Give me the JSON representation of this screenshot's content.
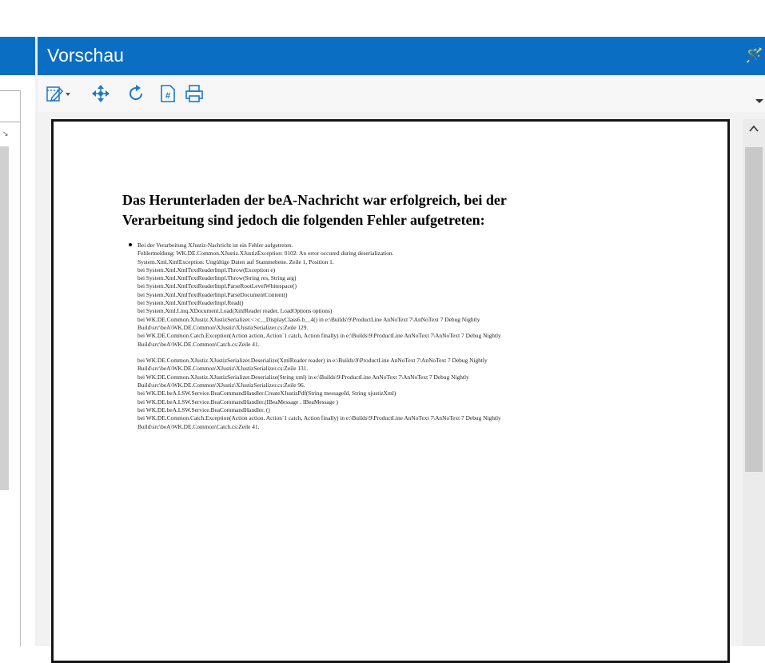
{
  "pane": {
    "title": "Vorschau",
    "pin_icon": "pin-icon",
    "colors": {
      "header": "#0a6fc2",
      "icon": "#1a78c8"
    }
  },
  "toolbar": {
    "icons": [
      "edit-dropdown-icon",
      "move-icon",
      "refresh-icon",
      "page-number-icon",
      "print-icon"
    ]
  },
  "document": {
    "heading_line1": "Das Herunterladen der beA-Nachricht war erfolgreich, bei der",
    "heading_line2": "Verarbeitung sind jedoch die folgenden Fehler aufgetreten:",
    "error_lines": [
      "Bei der Verarbeitung XJustiz-Nachricht ist ein Fehler aufgetreten.",
      "Fehlermeldung: WK.DE.Common.XJustiz.XJustizException: 0102: An error occured during deserialization.",
      "System.Xml.XmlException: Ungültige Daten auf Stammebene. Zeile 1, Position 1.",
      "bei System.Xml.XmlTextReaderImpl.Throw(Exception e)",
      "bei System.Xml.XmlTextReaderImpl.Throw(String res, String arg)",
      "bei System.Xml.XmlTextReaderImpl.ParseRootLevelWhitespace()",
      "bei System.Xml.XmlTextReaderImpl.ParseDocumentContent()",
      "bei System.Xml.XmlTextReaderImpl.Read()",
      "bei System.Xml.Linq.XDocument.Load(XmlReader reader, LoadOptions options)",
      "bei WK.DE.Common.XJustiz.XJustizSerializer.<>c__DisplayClass6.b__4() in e:\\Builds\\9\\ProductLine AnNoText 7\\AnNoText 7 Debug Nightly",
      "Build\\src\\beA\\WK.DE.Common\\XJustiz\\XJustizSerializer.cs:Zeile 129.",
      "bei WK.DE.Common.Catch.Exception(Action action, Action`1 catch, Action finally) in e:\\Builds\\9\\ProductLine AnNoText 7\\AnNoText 7 Debug Nightly",
      "Build\\src\\beA\\WK.DE.Common\\Catch.cs:Zeile 41.",
      "",
      "bei WK.DE.Common.XJustiz.XJustizSerializer.Deserialize(XmlReader reader) in e:\\Builds\\9\\ProductLine AnNoText 7\\AnNoText 7 Debug Nightly",
      "Build\\src\\beA\\WK.DE.Common\\XJustiz\\XJustizSerializer.cs:Zeile 131.",
      "bei WK.DE.Common.XJustiz.XJustizSerializer.Deserialize(String xml) in e:\\Builds\\9\\ProductLine AnNoText 7\\AnNoText 7 Debug Nightly",
      "Build\\src\\beA\\WK.DE.Common\\XJustiz\\XJustizSerializer.cs:Zeile 96.",
      "bei WK.DE.beA.LSW.Service.BeaCommandHandler.CreateXJustizPdf(String messageId, String xjustizXml)",
      "bei WK.DE.beA.LSW.Service.BeaCommandHandler.(IBeaMessage , IBeaMessage )",
      "bei WK.DE.beA.LSW.Service.BeaCommandHandler.    ()",
      "bei WK.DE.Common.Catch.Exception(Action action, Action`1 catch, Action finally) in e:\\Builds\\9\\ProductLine AnNoText 7\\AnNoText 7 Debug Nightly",
      "Build\\src\\beA\\WK.DE.Common\\Catch.cs:Zeile 41."
    ]
  }
}
